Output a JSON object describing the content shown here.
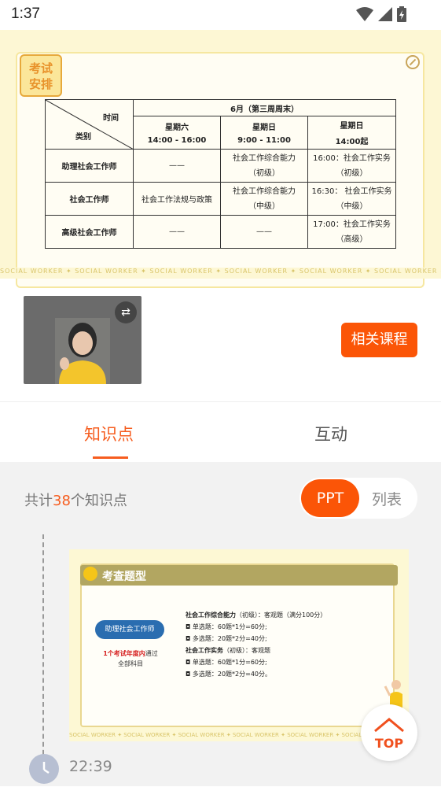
{
  "status_bar": {
    "time": "1:37"
  },
  "slide_top": {
    "badge": "考试\n安排",
    "table": {
      "corner_top": "时间",
      "corner_bottom": "类别",
      "month_header": "6月（第三周周末）",
      "columns": [
        {
          "day": "星期六",
          "time": "14:00 - 16:00"
        },
        {
          "day": "星期日",
          "time": "9:00 - 11:00"
        },
        {
          "day": "星期日",
          "time": "14:00起"
        }
      ],
      "rows": [
        {
          "category": "助理社会工作师",
          "cells": [
            "——",
            "社会工作综合能力\n（初级）",
            "16:00：社会工作实务\n（初级）"
          ]
        },
        {
          "category": "社会工作师",
          "cells": [
            "社会工作法规与政策",
            "社会工作综合能力\n（中级）",
            "16:30： 社会工作实务\n（中级）"
          ]
        },
        {
          "category": "高级社会工作师",
          "cells": [
            "——",
            "——",
            "17:00：社会工作实务\n（高级）"
          ]
        }
      ]
    },
    "watermark": "SOCIAL WORKER ✦ SOCIAL WORKER ✦ SOCIAL WORKER ✦ SOCIAL WORKER ✦ SOCIAL WORKER ✦ SOCIAL WORKER ✦ SOCIAL WORKER ✦ SOCIAL WORKER ✦ SOCIAL WORKER"
  },
  "video": {
    "swap_icon": "⇄"
  },
  "related_button": "相关课程",
  "tabs": {
    "knowledge": "知识点",
    "interaction": "互动"
  },
  "summary": {
    "prefix": "共计",
    "count": "38",
    "suffix": "个知识点"
  },
  "view_toggle": {
    "ppt": "PPT",
    "list": "列表"
  },
  "slide2": {
    "title": "考查题型",
    "pill": "助理社会工作师",
    "note_red": "1个考试年度内",
    "note_rest": "通过",
    "note_line2": "全部科目",
    "lines": [
      {
        "bold": "社会工作综合能力",
        "text": "（初级）：客观题（满分100分）"
      },
      {
        "bold": "",
        "text": "◘  单选题：60题*1分=60分;"
      },
      {
        "bold": "",
        "text": "◘  多选题：20题*2分=40分;"
      },
      {
        "bold": "社会工作实务",
        "text": "（初级）：客观题"
      },
      {
        "bold": "",
        "text": "◘  单选题：60题*1分=60分;"
      },
      {
        "bold": "",
        "text": "◘  多选题：20题*2分=40分。"
      }
    ],
    "watermark": "SOCIAL WORKER ✦ SOCIAL WORKER ✦ SOCIAL WORKER ✦ SOCIAL WORKER ✦ SOCIAL WORKER ✦ SOCIAL WORKER ✦ SOCIAL WORKER"
  },
  "top_button": "TOP",
  "timeline_time": "22:39"
}
